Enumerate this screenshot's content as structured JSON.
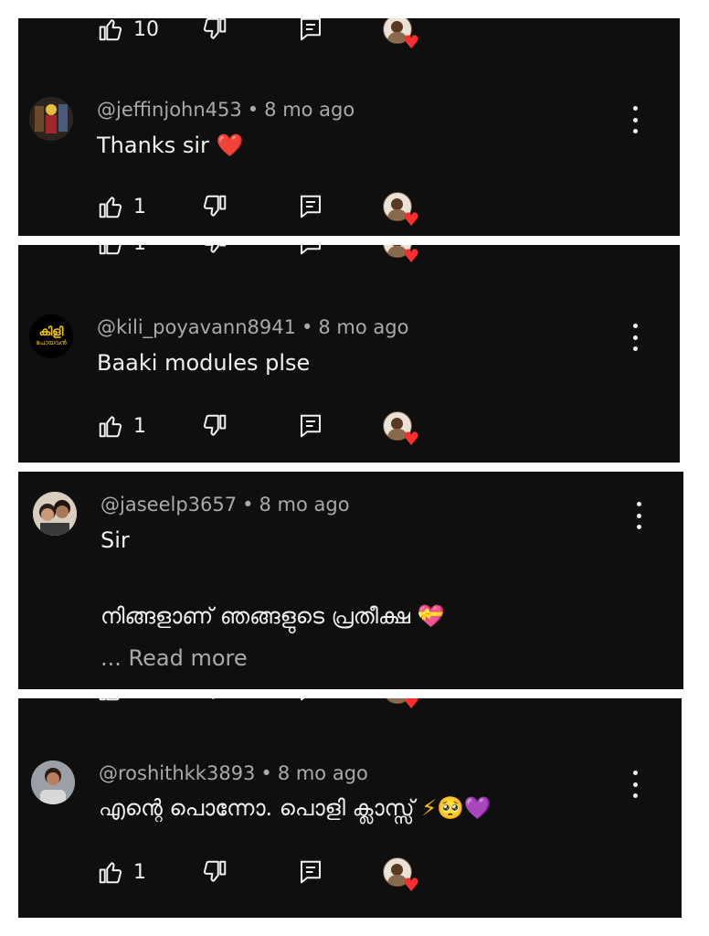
{
  "panels": [
    {
      "partial_like_count": "10",
      "comment": {
        "handle": "@jeffinjohn453",
        "time": "8 mo ago",
        "text": "Thanks sir",
        "emoji": "❤️",
        "like_count": "1"
      }
    },
    {
      "partial_like_count": "1",
      "comment": {
        "handle": "@kili_poyavann8941",
        "time": "8 mo ago",
        "text": "Baaki modules plse",
        "like_count": "1",
        "avatar_text": "കിളി",
        "avatar_subtext": "പോയവൻ"
      }
    },
    {
      "comment": {
        "handle": "@jaseelp3657",
        "time": "8 mo ago",
        "text_line1": "Sir",
        "text_line2": "നിങ്ങളാണ് ഞങ്ങളുടെ പ്രതീക്ഷ",
        "emoji": "💝",
        "read_more": "... Read more"
      }
    },
    {
      "comment": {
        "handle": "@roshithkk3893",
        "time": "8 mo ago",
        "text": "എന്റെ പൊന്നോ. പൊളി ക്ലാസ്സ്",
        "emoji": "⚡🥺💜",
        "like_count": "1"
      }
    }
  ],
  "separator": "•",
  "colors": {
    "background": "#0f0f0f",
    "text_primary": "#f1f1f1",
    "text_secondary": "#aaaaaa",
    "heart": "#ff2d2d"
  },
  "icons": [
    "like-icon",
    "dislike-icon",
    "reply-icon",
    "more-vert-icon",
    "creator-heart-icon"
  ]
}
